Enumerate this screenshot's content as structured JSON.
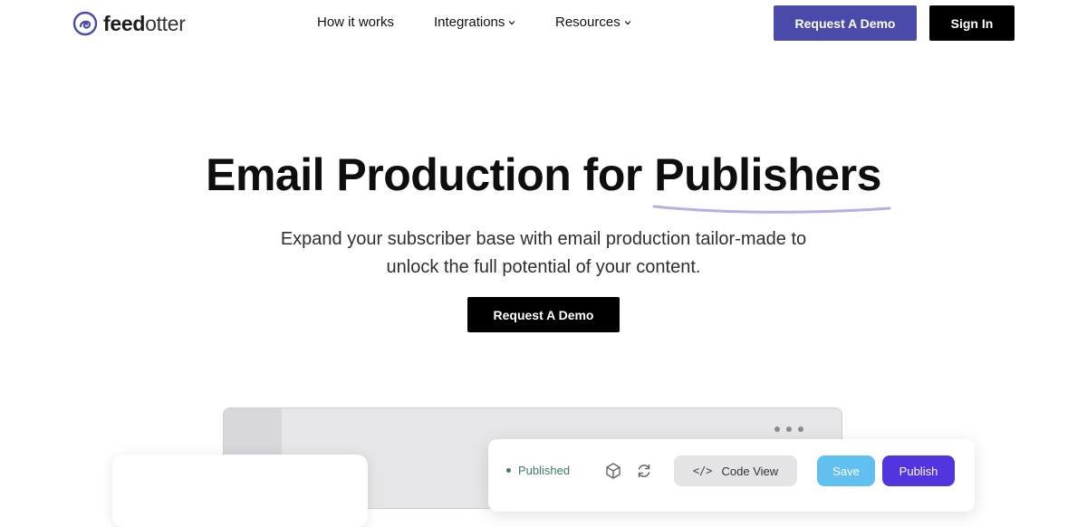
{
  "brand": {
    "name_bold": "feed",
    "name_regular": "otter"
  },
  "nav": {
    "links": [
      {
        "label": "How it works",
        "has_dropdown": false
      },
      {
        "label": "Integrations",
        "has_dropdown": true
      },
      {
        "label": "Resources",
        "has_dropdown": true
      }
    ],
    "demo_button": "Request A Demo",
    "signin_button": "Sign In"
  },
  "hero": {
    "title_prefix": "Email Production for",
    "title_highlight": "Publishers",
    "subtitle_line1": "Expand your subscriber base with email production tailor-made to",
    "subtitle_line2": "unlock the full potential of your content.",
    "cta_button": "Request A Demo"
  },
  "mockup": {
    "status": "Published",
    "code_view_button": "Code View",
    "save_button": "Save",
    "publish_button": "Publish",
    "icons": [
      "cube-icon",
      "refresh-icon",
      "code-icon"
    ]
  },
  "colors": {
    "brand_purple": "#4a4aab",
    "black": "#000000",
    "published_green": "#3f7a64",
    "save_blue": "#61c0f0",
    "publish_violet": "#5335e0",
    "underline_lavender": "#b3b0e6"
  }
}
